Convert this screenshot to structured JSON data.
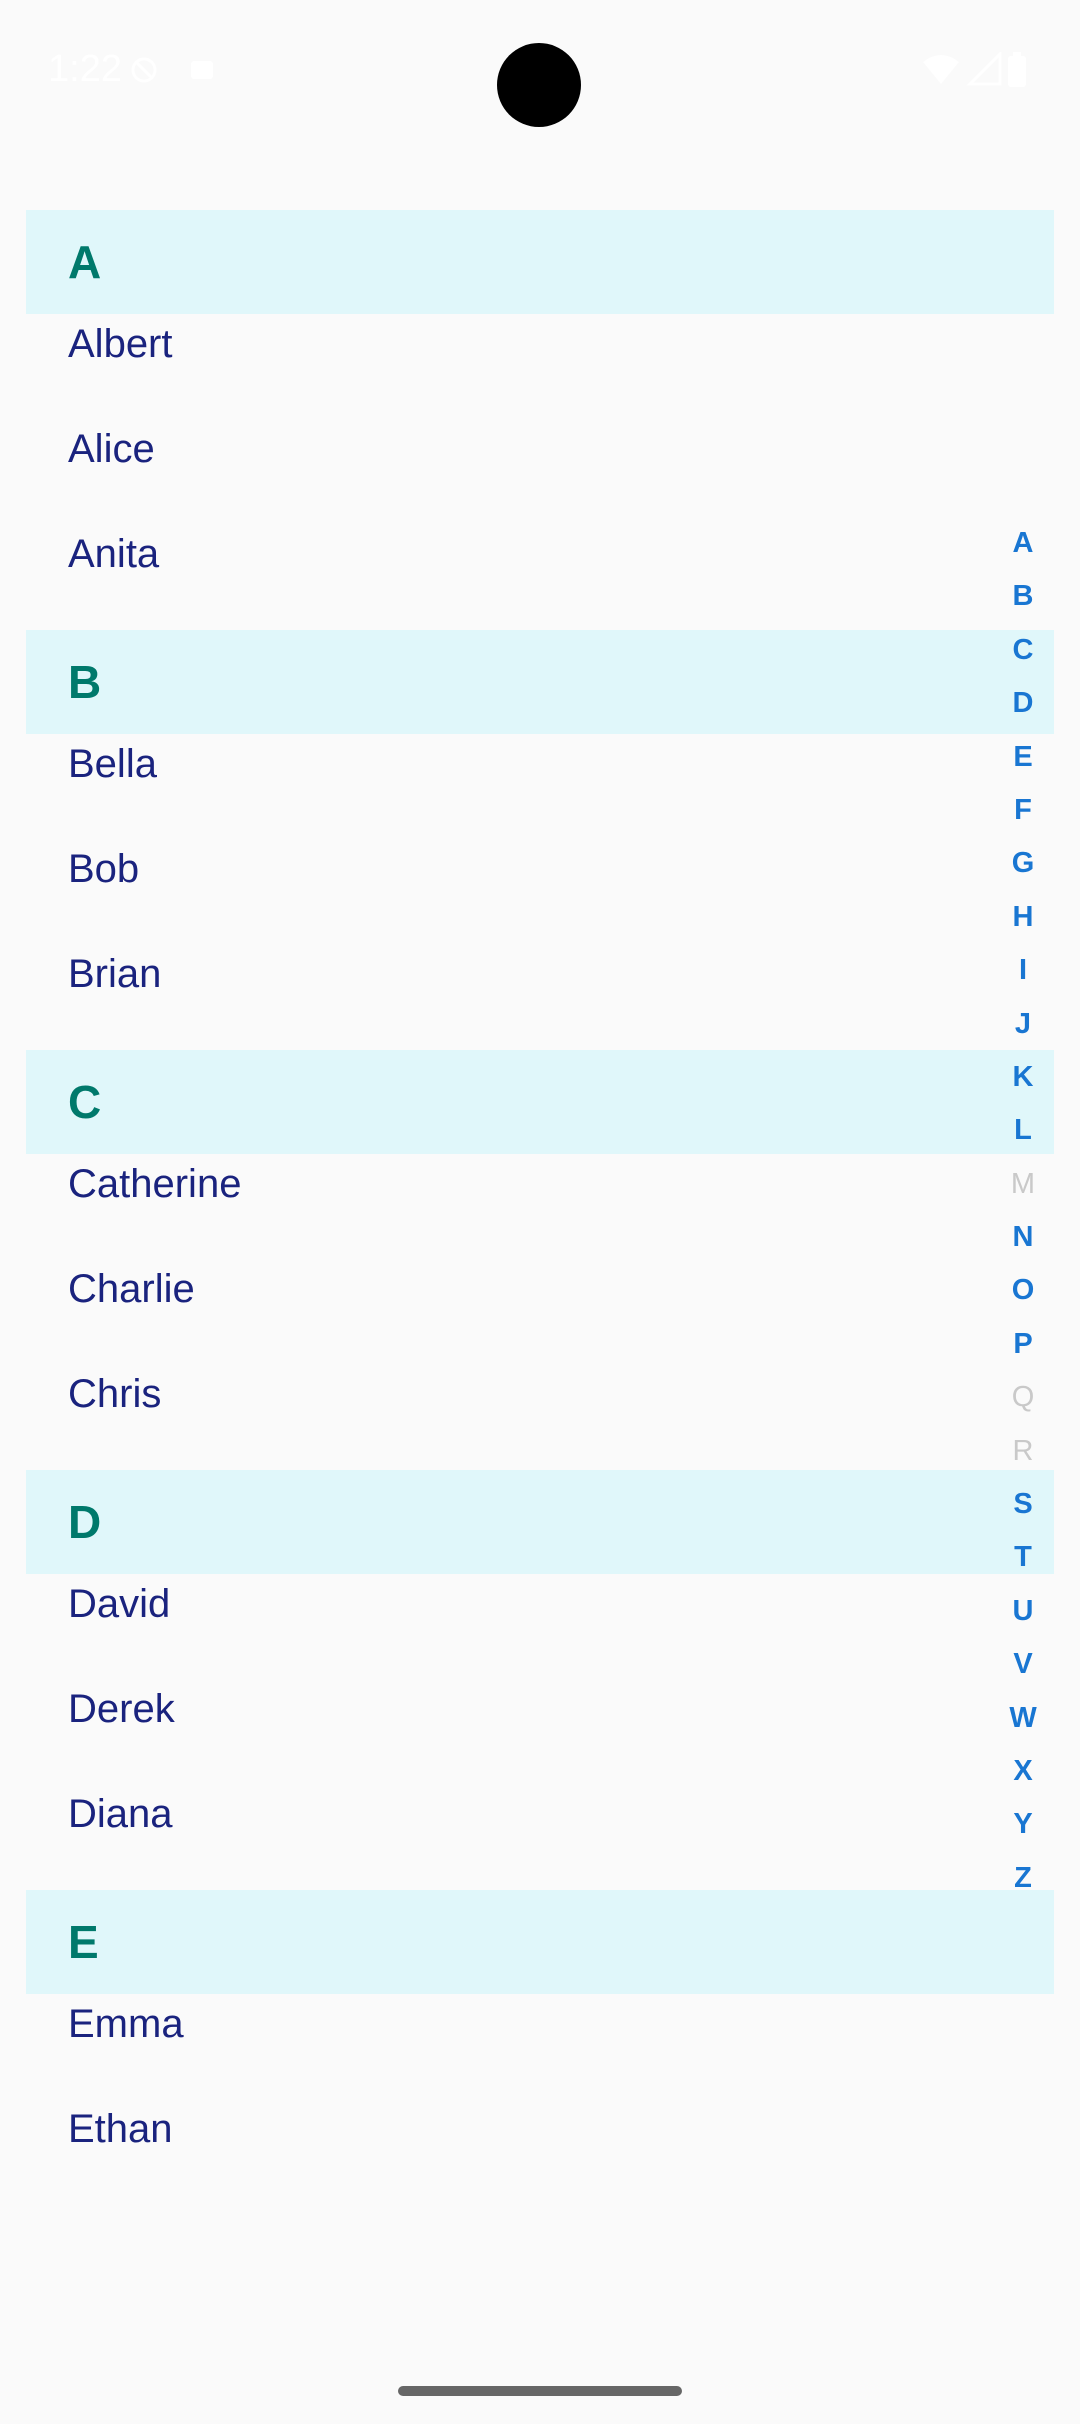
{
  "status_bar": {
    "time": "1:22",
    "icons": [
      "vpn-key-icon",
      "notification-icon",
      "wifi-icon",
      "signal-icon",
      "battery-icon"
    ]
  },
  "colors": {
    "header_bg": "#e0f7fa",
    "header_text": "#00796b",
    "item_text": "#1a237e",
    "index_active": "#1976d2",
    "index_disabled": "#c9c9c9",
    "background": "#fafafa"
  },
  "sections": [
    {
      "letter": "A",
      "items": [
        "Albert",
        "Alice",
        "Anita"
      ]
    },
    {
      "letter": "B",
      "items": [
        "Bella",
        "Bob",
        "Brian"
      ]
    },
    {
      "letter": "C",
      "items": [
        "Catherine",
        "Charlie",
        "Chris"
      ]
    },
    {
      "letter": "D",
      "items": [
        "David",
        "Derek",
        "Diana"
      ]
    },
    {
      "letter": "E",
      "items": [
        "Emma",
        "Ethan"
      ]
    }
  ],
  "alphabet_index": [
    {
      "letter": "A",
      "enabled": true
    },
    {
      "letter": "B",
      "enabled": true
    },
    {
      "letter": "C",
      "enabled": true
    },
    {
      "letter": "D",
      "enabled": true
    },
    {
      "letter": "E",
      "enabled": true
    },
    {
      "letter": "F",
      "enabled": true
    },
    {
      "letter": "G",
      "enabled": true
    },
    {
      "letter": "H",
      "enabled": true
    },
    {
      "letter": "I",
      "enabled": true
    },
    {
      "letter": "J",
      "enabled": true
    },
    {
      "letter": "K",
      "enabled": true
    },
    {
      "letter": "L",
      "enabled": true
    },
    {
      "letter": "M",
      "enabled": false
    },
    {
      "letter": "N",
      "enabled": true
    },
    {
      "letter": "O",
      "enabled": true
    },
    {
      "letter": "P",
      "enabled": true
    },
    {
      "letter": "Q",
      "enabled": false
    },
    {
      "letter": "R",
      "enabled": false
    },
    {
      "letter": "S",
      "enabled": true
    },
    {
      "letter": "T",
      "enabled": true
    },
    {
      "letter": "U",
      "enabled": true
    },
    {
      "letter": "V",
      "enabled": true
    },
    {
      "letter": "W",
      "enabled": true
    },
    {
      "letter": "X",
      "enabled": true
    },
    {
      "letter": "Y",
      "enabled": true
    },
    {
      "letter": "Z",
      "enabled": true
    }
  ]
}
